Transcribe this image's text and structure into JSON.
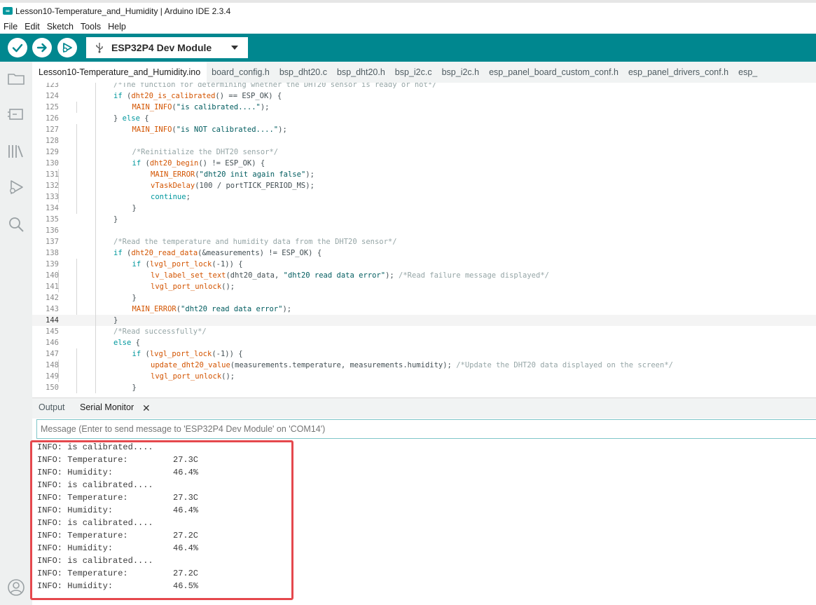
{
  "window": {
    "title": "Lesson10-Temperature_and_Humidity | Arduino IDE 2.3.4",
    "app_icon": "arduino-logo-icon"
  },
  "menu": [
    "File",
    "Edit",
    "Sketch",
    "Tools",
    "Help"
  ],
  "toolbar": {
    "verify_icon": "verify-check-icon",
    "upload_icon": "upload-arrow-icon",
    "debug_icon": "debug-icon",
    "board": "ESP32P4 Dev Module",
    "usb_icon": "usb-icon",
    "accent": "#00878f"
  },
  "sidebar": [
    "sketchbook-folder-icon",
    "boards-manager-icon",
    "library-manager-icon",
    "debug-icon",
    "search-icon",
    "account-icon"
  ],
  "tabs": [
    "Lesson10-Temperature_and_Humidity.ino",
    "board_config.h",
    "bsp_dht20.c",
    "bsp_dht20.h",
    "bsp_i2c.c",
    "bsp_i2c.h",
    "esp_panel_board_custom_conf.h",
    "esp_panel_drivers_conf.h",
    "esp_"
  ],
  "editor": {
    "current_line": 144,
    "lines": [
      {
        "n": 123,
        "indent": 2,
        "code": "/*The function for determining whether the DHT20 sensor is ready or not*/"
      },
      {
        "n": 124,
        "indent": 2,
        "code": "if (dht20_is_calibrated() == ESP_OK) {"
      },
      {
        "n": 125,
        "indent": 3,
        "code": "MAIN_INFO(\"is calibrated....\");"
      },
      {
        "n": 126,
        "indent": 2,
        "code": "} else {"
      },
      {
        "n": 127,
        "indent": 3,
        "code": "MAIN_INFO(\"is NOT calibrated....\");"
      },
      {
        "n": 128,
        "indent": 3,
        "code": ""
      },
      {
        "n": 129,
        "indent": 3,
        "code": "/*Reinitialize the DHT20 sensor*/"
      },
      {
        "n": 130,
        "indent": 3,
        "code": "if (dht20_begin() != ESP_OK) {"
      },
      {
        "n": 131,
        "indent": 4,
        "code": "MAIN_ERROR(\"dht20 init again false\");"
      },
      {
        "n": 132,
        "indent": 4,
        "code": "vTaskDelay(100 / portTICK_PERIOD_MS);"
      },
      {
        "n": 133,
        "indent": 4,
        "code": "continue;"
      },
      {
        "n": 134,
        "indent": 3,
        "code": "}"
      },
      {
        "n": 135,
        "indent": 2,
        "code": "}"
      },
      {
        "n": 136,
        "indent": 2,
        "code": ""
      },
      {
        "n": 137,
        "indent": 2,
        "code": "/*Read the temperature and humidity data from the DHT20 sensor*/"
      },
      {
        "n": 138,
        "indent": 2,
        "code": "if (dht20_read_data(&measurements) != ESP_OK) {"
      },
      {
        "n": 139,
        "indent": 3,
        "code": "if (lvgl_port_lock(-1)) {"
      },
      {
        "n": 140,
        "indent": 4,
        "code": "lv_label_set_text(dht20_data, \"dht20 read data error\"); /*Read failure message displayed*/"
      },
      {
        "n": 141,
        "indent": 4,
        "code": "lvgl_port_unlock();"
      },
      {
        "n": 142,
        "indent": 3,
        "code": "}"
      },
      {
        "n": 143,
        "indent": 3,
        "code": "MAIN_ERROR(\"dht20 read data error\");"
      },
      {
        "n": 144,
        "indent": 2,
        "code": "}"
      },
      {
        "n": 145,
        "indent": 2,
        "code": "/*Read successfully*/"
      },
      {
        "n": 146,
        "indent": 2,
        "code": "else {"
      },
      {
        "n": 147,
        "indent": 3,
        "code": "if (lvgl_port_lock(-1)) {"
      },
      {
        "n": 148,
        "indent": 4,
        "code": "update_dht20_value(measurements.temperature, measurements.humidity); /*Update the DHT20 data displayed on the screen*/"
      },
      {
        "n": 149,
        "indent": 4,
        "code": "lvgl_port_unlock();"
      },
      {
        "n": 150,
        "indent": 3,
        "code": "}"
      }
    ]
  },
  "panel": {
    "tabs": [
      "Output",
      "Serial Monitor"
    ],
    "active_tab": "Serial Monitor",
    "close_icon": "close-icon",
    "message_placeholder": "Message (Enter to send message to 'ESP32P4 Dev Module' on 'COM14')",
    "serial_lines": [
      {
        "label": "INFO: is calibrated....",
        "value": ""
      },
      {
        "label": "INFO: Temperature:",
        "value": "27.3C"
      },
      {
        "label": "INFO: Humidity:",
        "value": "46.4%"
      },
      {
        "label": "INFO: is calibrated....",
        "value": ""
      },
      {
        "label": "INFO: Temperature:",
        "value": "27.3C"
      },
      {
        "label": "INFO: Humidity:",
        "value": "46.4%"
      },
      {
        "label": "INFO: is calibrated....",
        "value": ""
      },
      {
        "label": "INFO: Temperature:",
        "value": "27.2C"
      },
      {
        "label": "INFO: Humidity:",
        "value": "46.4%"
      },
      {
        "label": "INFO: is calibrated....",
        "value": ""
      },
      {
        "label": "INFO: Temperature:",
        "value": "27.2C"
      },
      {
        "label": "INFO: Humidity:",
        "value": "46.5%"
      }
    ],
    "highlight_color": "#e5484d"
  }
}
